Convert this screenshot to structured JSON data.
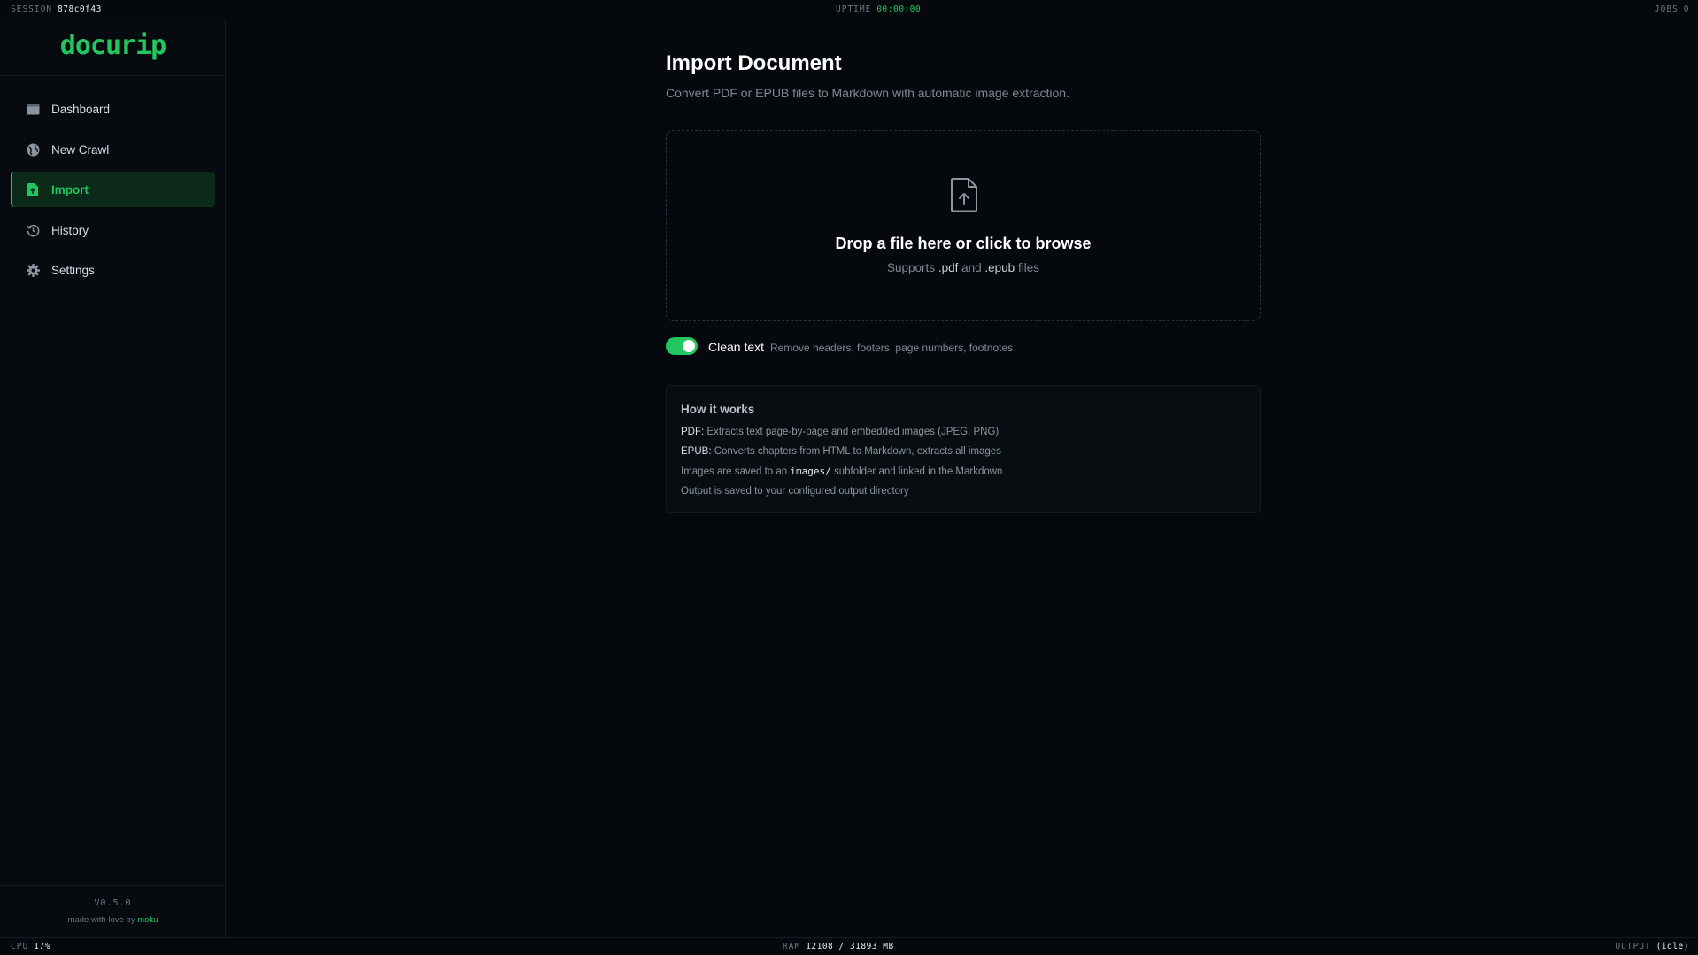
{
  "topbar": {
    "session_label": "SESSION",
    "session_value": "878c0f43",
    "uptime_label": "UPTIME",
    "uptime_value": "00:00:00",
    "jobs_label": "JOBS",
    "jobs_value": "0"
  },
  "sidebar": {
    "logo": "docurip",
    "items": [
      {
        "label": "Dashboard",
        "icon": "dashboard-icon",
        "active": false
      },
      {
        "label": "New Crawl",
        "icon": "globe-icon",
        "active": false
      },
      {
        "label": "Import",
        "icon": "file-import-icon",
        "active": true
      },
      {
        "label": "History",
        "icon": "history-icon",
        "active": false
      },
      {
        "label": "Settings",
        "icon": "gear-icon",
        "active": false
      }
    ],
    "version": "V0.5.0",
    "made_by_prefix": "made with love by",
    "made_by_link": "moku"
  },
  "main": {
    "title": "Import Document",
    "subtitle": "Convert PDF or EPUB files to Markdown with automatic image extraction.",
    "dropzone": {
      "title": "Drop a file here or click to browse",
      "sub_prefix": "Supports",
      "ext1": ".pdf",
      "sub_mid": "and",
      "ext2": ".epub",
      "sub_suffix": "files"
    },
    "clean_text": {
      "enabled": true,
      "label": "Clean text",
      "description": "Remove headers, footers, page numbers, footnotes"
    },
    "how": {
      "title": "How it works",
      "pdf_label": "PDF:",
      "pdf_text": "Extracts text page-by-page and embedded images (JPEG, PNG)",
      "epub_label": "EPUB:",
      "epub_text": "Converts chapters from HTML to Markdown, extracts all images",
      "images_prefix": "Images are saved to an",
      "images_code": "images/",
      "images_suffix": "subfolder and linked in the Markdown",
      "output_text": "Output is saved to your configured output directory"
    }
  },
  "botbar": {
    "cpu_label": "CPU",
    "cpu_value": "17%",
    "ram_label": "RAM",
    "ram_value": "12108 / 31893 MB",
    "output_label": "OUTPUT",
    "output_value": "(idle)"
  },
  "colors": {
    "accent": "#22c55e",
    "background": "#05090d",
    "sidebar_active_bg": "#0b2a1a"
  }
}
